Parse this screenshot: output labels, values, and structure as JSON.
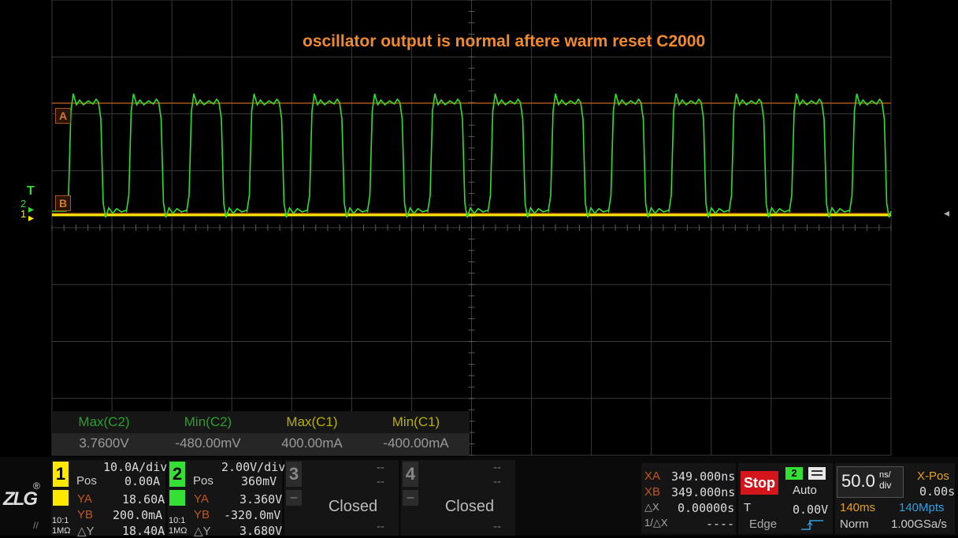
{
  "annotation": "oscillator output is normal aftere warm reset C2000",
  "markers": {
    "cursor_a": "A",
    "cursor_b": "B",
    "trigger": "T",
    "ch2_ref": "2",
    "ch1_ref": "1"
  },
  "measurements": [
    {
      "label": "Max(C2)",
      "value": "3.7600V",
      "color": "#2aa02a"
    },
    {
      "label": "Min(C2)",
      "value": "-480.00mV",
      "color": "#2aa02a"
    },
    {
      "label": "Max(C1)",
      "value": "400.00mA",
      "color": "#b8b000"
    },
    {
      "label": "Min(C1)",
      "value": "-400.00mA",
      "color": "#b8b000"
    }
  ],
  "ch1": {
    "num": "1",
    "scale": "10.0A/div",
    "pos_label": "Pos",
    "pos": "0.00A",
    "ya_label": "YA",
    "ya": "18.60A",
    "yb_label": "YB",
    "yb": "200.0mA",
    "dy_label": "△Y",
    "dy": "18.40A",
    "probe": "10:1",
    "imp": "1MΩ",
    "color": "#ffe800"
  },
  "ch2": {
    "num": "2",
    "scale": "2.00V/div",
    "pos_label": "Pos",
    "pos": "360mV",
    "ya_label": "YA",
    "ya": "3.360V",
    "yb_label": "YB",
    "yb": "-320.0mV",
    "dy_label": "△Y",
    "dy": "3.680V",
    "probe": "10:1",
    "imp": "1MΩ",
    "color": "#33e033"
  },
  "ch3": {
    "num": "3",
    "status": "Closed",
    "dash": "--"
  },
  "ch4": {
    "num": "4",
    "status": "Closed",
    "dash": "--"
  },
  "cursors": {
    "xa_label": "XA",
    "xa": "349.000ns",
    "xb_label": "XB",
    "xb": "349.000ns",
    "dx_label": "△X",
    "dx": "0.00000s",
    "inv_label": "1/△X",
    "inv": "----"
  },
  "run_state": "Stop",
  "trigger": {
    "source": "2",
    "mode": "Auto",
    "t_label": "T",
    "level": "0.00V",
    "type": "Edge"
  },
  "timebase": {
    "value": "50.0",
    "unit_top": "ns/",
    "unit_bottom": "div",
    "xpos_label": "X-Pos",
    "xpos": "0.00s",
    "length": "140ms",
    "memory": "140Mpts",
    "acq_mode": "Norm",
    "sample_rate": "1.00GSa/s"
  },
  "brand": "ZLG"
}
